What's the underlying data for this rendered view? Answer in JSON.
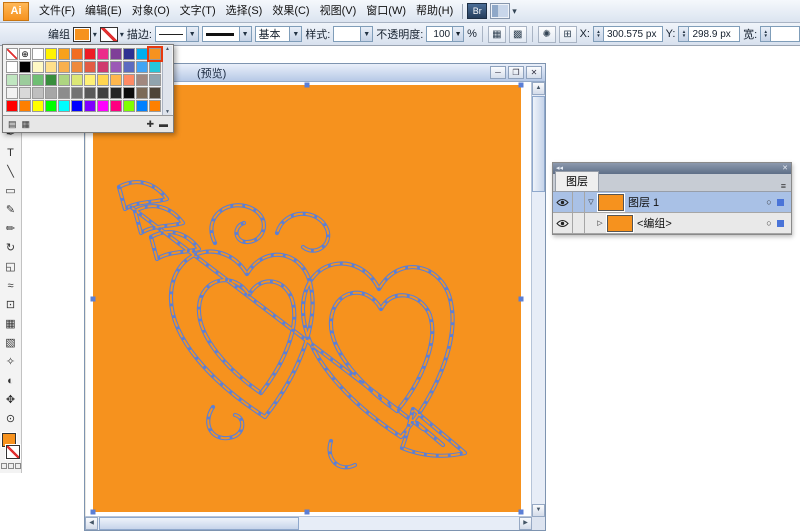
{
  "app": {
    "logo_text": "Ai",
    "menus": [
      "文件(F)",
      "编辑(E)",
      "对象(O)",
      "文字(T)",
      "选择(S)",
      "效果(C)",
      "视图(V)",
      "窗口(W)",
      "帮助(H)"
    ],
    "bridge_label": "Br"
  },
  "control_bar": {
    "context_label": "编组",
    "fill_color": "#F6921E",
    "stroke_label": "描边:",
    "brush_label": "基本",
    "style_label": "样式:",
    "opacity_label": "不透明度:",
    "opacity_value": "100",
    "opacity_unit": "%",
    "icons": [
      {
        "name": "align-panel-icon",
        "glyph": "▦"
      },
      {
        "name": "pathfinder-panel-icon",
        "glyph": "▩"
      },
      {
        "name": "sep"
      },
      {
        "name": "appearance-icon",
        "glyph": "✺"
      },
      {
        "name": "transform-panel-icon",
        "glyph": "⊞"
      }
    ],
    "x_label": "X:",
    "x_value": "300.575 px",
    "y_label": "Y:",
    "y_value": "298.9 px",
    "width_label": "宽:"
  },
  "swatches_panel": {
    "selected": {
      "row": 0,
      "col": 11
    },
    "rows": [
      [
        "none",
        "reg",
        "#FFFFFF",
        "#FFF200",
        "#F9A11B",
        "#F26D21",
        "#ED1C24",
        "#EC2B8A",
        "#7F3F98",
        "#2E3192",
        "#00AEEF",
        "#F6921E"
      ],
      [
        "#FFFFFF",
        "#000000",
        "#FFF9C4",
        "#FFE08A",
        "#F9B04E",
        "#EF8A3C",
        "#E25C44",
        "#CF3A6E",
        "#9B59B6",
        "#5C6BC0",
        "#42A5F5",
        "#26C6DA"
      ],
      [
        "#C0E6C0",
        "#9CCC9C",
        "#6FBF73",
        "#388E3C",
        "#AED581",
        "#DCE775",
        "#FFF176",
        "#FFD54F",
        "#FFB74D",
        "#FF8A65",
        "#A1887F",
        "#90A4AE"
      ],
      [
        "#F2F2F2",
        "#D9D9D9",
        "#BFBFBF",
        "#A6A6A6",
        "#8C8C8C",
        "#737373",
        "#595959",
        "#404040",
        "#262626",
        "#0D0D0D",
        "#7B6A58",
        "#4E4539"
      ],
      [
        "#FF0000",
        "#FF7F00",
        "#FFFF00",
        "#00FF00",
        "#00FFFF",
        "#0000FF",
        "#7F00FF",
        "#FF00FF",
        "#FF0080",
        "#80FF00",
        "#0080FF",
        "#FF8000"
      ]
    ],
    "footer_icons": [
      {
        "name": "swatch-libraries-icon",
        "glyph": "▤"
      },
      {
        "name": "swatch-kinds-icon",
        "glyph": "▦"
      },
      {
        "name": "new-swatch-icon",
        "glyph": "✚",
        "push": true
      },
      {
        "name": "delete-swatch-icon",
        "glyph": "▬"
      }
    ]
  },
  "toolbar": {
    "tools": [
      {
        "name": "selection-tool",
        "glyph": "➤"
      },
      {
        "name": "direct-selection-tool",
        "glyph": "▷"
      },
      {
        "name": "magic-wand-tool",
        "glyph": "✶"
      },
      {
        "name": "lasso-tool",
        "glyph": "◌"
      },
      {
        "name": "pen-tool",
        "glyph": "✒"
      },
      {
        "name": "type-tool",
        "glyph": "T"
      },
      {
        "name": "line-tool",
        "glyph": "╲"
      },
      {
        "name": "rectangle-tool",
        "glyph": "▭"
      },
      {
        "name": "paintbrush-tool",
        "glyph": "✎"
      },
      {
        "name": "pencil-tool",
        "glyph": "✏"
      },
      {
        "name": "rotate-tool",
        "glyph": "↻"
      },
      {
        "name": "scale-tool",
        "glyph": "◱"
      },
      {
        "name": "warp-tool",
        "glyph": "≈"
      },
      {
        "name": "free-transform-tool",
        "glyph": "⊡"
      },
      {
        "name": "mesh-tool",
        "glyph": "▦"
      },
      {
        "name": "gradient-tool",
        "glyph": "▧"
      },
      {
        "name": "eyedropper-tool",
        "glyph": "✧"
      },
      {
        "name": "blend-tool",
        "glyph": "◐"
      },
      {
        "name": "hand-tool",
        "glyph": "✥"
      },
      {
        "name": "zoom-tool",
        "glyph": "⊙"
      }
    ]
  },
  "document": {
    "title": "(预览)",
    "artboard_color": "#F6921E",
    "selection_color": "#5B7FD6",
    "window": {
      "minimize": "─",
      "restore": "❐",
      "close": "✕"
    }
  },
  "layers_panel": {
    "tab_label": "图层",
    "collapse_glyph": "◂◂",
    "close_glyph": "✕",
    "menu_glyph": "≡",
    "rows": [
      {
        "label": "图层 1",
        "expand": "▽",
        "selected": true,
        "thumb": "#F6921E",
        "indicator": "#4A74D8"
      },
      {
        "label": "<编组>",
        "expand": "▷",
        "selected": false,
        "thumb": "#F6921E",
        "indicator": "#4A74D8",
        "indent": 1
      }
    ]
  }
}
